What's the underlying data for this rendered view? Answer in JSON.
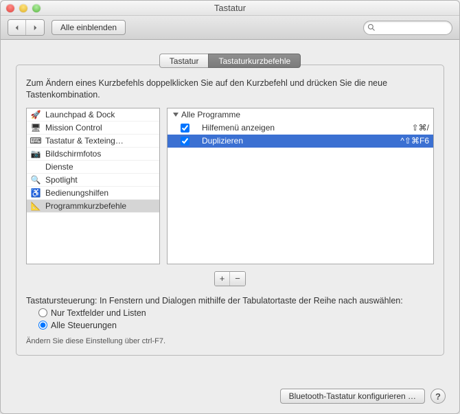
{
  "title": "Tastatur",
  "toolbar": {
    "show_all_label": "Alle einblenden",
    "search_placeholder": ""
  },
  "tabs": {
    "keyboard": "Tastatur",
    "shortcuts": "Tastaturkurzbefehle"
  },
  "desc": "Zum Ändern eines Kurzbefehls doppelklicken Sie auf den Kurzbefehl und drücken Sie die neue Tastenkombination.",
  "categories": [
    {
      "label": "Launchpad & Dock",
      "icon": "🚀",
      "color": ""
    },
    {
      "label": "Mission Control",
      "icon": "🖥",
      "color": ""
    },
    {
      "label": "Tastatur & Texteing…",
      "icon": "⌨",
      "color": ""
    },
    {
      "label": "Bildschirmfotos",
      "icon": "📷",
      "color": ""
    },
    {
      "label": "Dienste",
      "icon": "",
      "color": ""
    },
    {
      "label": "Spotlight",
      "icon": "🔍",
      "color": ""
    },
    {
      "label": "Bedienungshilfen",
      "icon": "♿",
      "color": ""
    },
    {
      "label": "Programmkurzbefehle",
      "icon": "📐",
      "color": ""
    }
  ],
  "selected_category_index": 7,
  "shortcuts": {
    "group_label": "Alle Programme",
    "items": [
      {
        "checked": true,
        "label": "Hilfemenü anzeigen",
        "keys": "⇧⌘/"
      },
      {
        "checked": true,
        "label": "Duplizieren",
        "keys": "^⇧⌘F6"
      }
    ],
    "selected_index": 1
  },
  "keyboard_control": {
    "heading": "Tastatursteuerung: In Fenstern und Dialogen mithilfe der Tabulatortaste der Reihe nach auswählen:",
    "option_text": "Nur Textfelder und Listen",
    "option_all": "Alle Steuerungen",
    "selected": "all",
    "hint": "Ändern Sie diese Einstellung über ctrl-F7."
  },
  "footer": {
    "bluetooth_btn": "Bluetooth-Tastatur konfigurieren …"
  }
}
